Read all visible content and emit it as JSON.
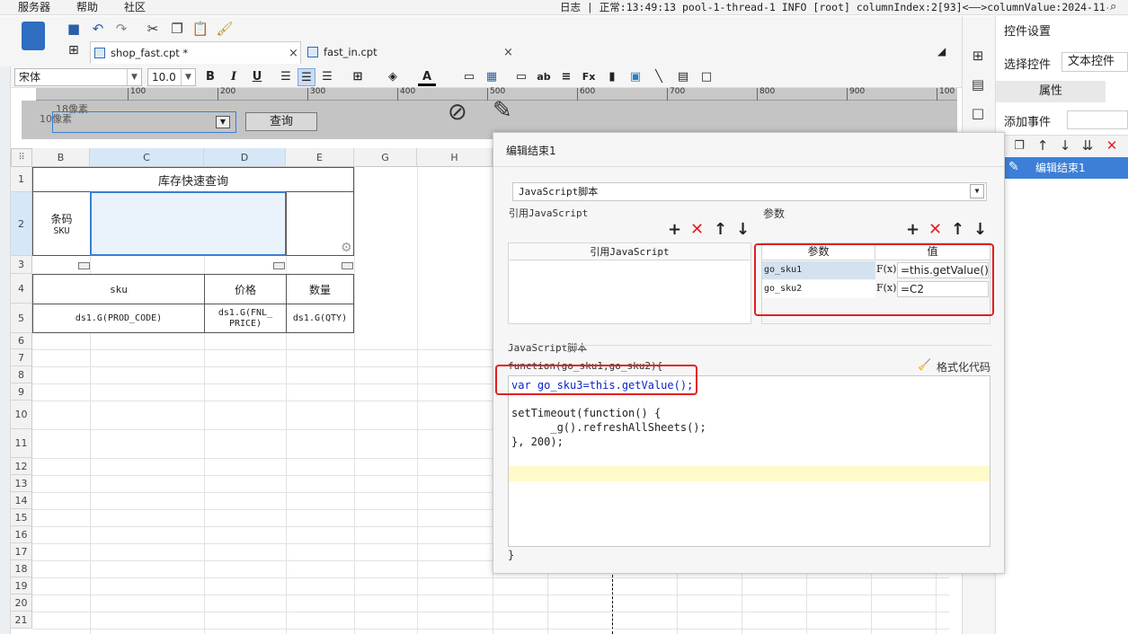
{
  "menu": {
    "items": [
      "服务器",
      "帮助",
      "社区"
    ]
  },
  "log": {
    "text": "日志 | 正常:13:49:13 pool-1-thread-1 INFO [root] columnIndex:2[93]<——>columnValue:2024-11-08 13:..."
  },
  "tabs": [
    {
      "label": "shop_fast.cpt *",
      "close": "×"
    },
    {
      "label": "fast_in.cpt",
      "close": "×"
    }
  ],
  "format": {
    "font": "宋体",
    "size": "10.0"
  },
  "ruler": {
    "ticks": [
      "100",
      "200",
      "300",
      "400",
      "500",
      "600",
      "700",
      "800",
      "900",
      "100"
    ]
  },
  "form": {
    "widget_hint1": "18像素",
    "widget_hint2": "10像素",
    "query_button": "查询"
  },
  "sheet": {
    "columns": [
      "B",
      "C",
      "D",
      "E",
      "G",
      "H"
    ],
    "rows": [
      "1",
      "2",
      "3",
      "4",
      "5",
      "6",
      "7",
      "8",
      "9",
      "10",
      "11",
      "12",
      "13",
      "14",
      "15",
      "16",
      "17",
      "18",
      "19",
      "20",
      "21"
    ],
    "title": "库存快速查询",
    "barcode_label": "条码",
    "barcode_sub": "SKU",
    "headers": [
      "sku",
      "价格",
      "数量"
    ],
    "formulas": [
      "ds1.G(PROD_CODE)",
      "ds1.G(FNL_",
      "PRICE)",
      "ds1.G(QTY)"
    ]
  },
  "dialog": {
    "title": "编辑结束1",
    "script_type": "JavaScript脚本",
    "ref_js_section": "引用JavaScript",
    "params_section": "参数",
    "ref_js_header": "引用JavaScript",
    "param_header_name": "参数",
    "param_header_value": "值",
    "params": [
      {
        "name": "go_sku1",
        "fx": "F(x)",
        "value": "=this.getValue()"
      },
      {
        "name": "go_sku2",
        "fx": "F(x)",
        "value": "=C2"
      }
    ],
    "js_section": "JavaScript脚本",
    "func_signature": "function(go_sku1,go_sku2){",
    "format_code": "格式化代码",
    "code_lines": [
      "var go_sku3=this.getValue();",
      "",
      "setTimeout(function() {",
      "      _g().refreshAllSheets();",
      "}, 200);"
    ],
    "closing_brace": "}"
  },
  "right_panel": {
    "title": "控件设置",
    "select_widget_label": "选择控件",
    "select_widget_value": "文本控件",
    "properties_tab": "属性",
    "add_event_label": "添加事件",
    "event_item": "编辑结束1"
  },
  "colors": {
    "accent": "#3b7fd1",
    "highlight": "#e32020",
    "code_yellow": "#fffbc8"
  }
}
